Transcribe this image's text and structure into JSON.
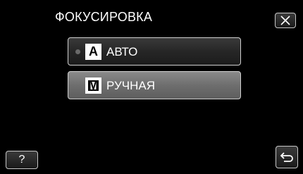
{
  "title": "ФОКУСИРОВКА",
  "options": [
    {
      "icon_letter": "A",
      "label": "АВТО",
      "selected": true
    },
    {
      "icon_letter": "M",
      "label": "РУЧНАЯ",
      "selected": false
    }
  ],
  "buttons": {
    "close_icon": "close-icon",
    "help_label": "?",
    "back_icon": "return-icon"
  }
}
